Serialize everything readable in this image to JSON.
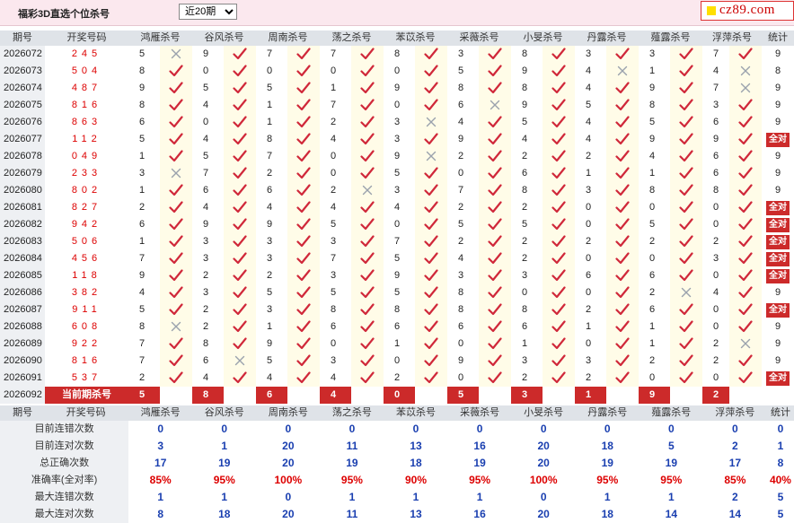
{
  "header": {
    "title": "福彩3D直选个位杀号",
    "period_select": {
      "selected": "近20期",
      "options": [
        "近20期"
      ]
    },
    "logo_text": "cz89.com"
  },
  "columns": [
    "期号",
    "开奖号码",
    "鸿雁杀号",
    "谷风杀号",
    "周南杀号",
    "荡之杀号",
    "苯苡杀号",
    "采薇杀号",
    "小旻杀号",
    "丹露杀号",
    "薤露杀号",
    "浮萍杀号",
    "统计"
  ],
  "quan_dui_label": "全对",
  "rows": [
    {
      "period": "2026072",
      "draw": "245",
      "kills": [
        5,
        9,
        7,
        7,
        8,
        3,
        8,
        3,
        3,
        7
      ],
      "ok": [
        0,
        1,
        1,
        1,
        1,
        1,
        1,
        1,
        1,
        1
      ],
      "stat": "9"
    },
    {
      "period": "2026073",
      "draw": "504",
      "kills": [
        8,
        0,
        0,
        0,
        0,
        5,
        9,
        4,
        1,
        4
      ],
      "ok": [
        1,
        1,
        1,
        1,
        1,
        1,
        1,
        0,
        1,
        0
      ],
      "stat": "8"
    },
    {
      "period": "2026074",
      "draw": "487",
      "kills": [
        9,
        5,
        5,
        1,
        9,
        8,
        8,
        4,
        9,
        7
      ],
      "ok": [
        1,
        1,
        1,
        1,
        1,
        1,
        1,
        1,
        1,
        0
      ],
      "stat": "9"
    },
    {
      "period": "2026075",
      "draw": "816",
      "kills": [
        8,
        4,
        1,
        7,
        0,
        6,
        9,
        5,
        8,
        3
      ],
      "ok": [
        1,
        1,
        1,
        1,
        1,
        0,
        1,
        1,
        1,
        1
      ],
      "stat": "9"
    },
    {
      "period": "2026076",
      "draw": "863",
      "kills": [
        6,
        0,
        1,
        2,
        3,
        4,
        5,
        4,
        5,
        6
      ],
      "ok": [
        1,
        1,
        1,
        1,
        0,
        1,
        1,
        1,
        1,
        1
      ],
      "stat": "9"
    },
    {
      "period": "2026077",
      "draw": "112",
      "kills": [
        5,
        4,
        8,
        4,
        3,
        9,
        4,
        4,
        9,
        9
      ],
      "ok": [
        1,
        1,
        1,
        1,
        1,
        1,
        1,
        1,
        1,
        1
      ],
      "stat": "全对"
    },
    {
      "period": "2026078",
      "draw": "049",
      "kills": [
        1,
        5,
        7,
        0,
        9,
        2,
        2,
        2,
        4,
        6
      ],
      "ok": [
        1,
        1,
        1,
        1,
        0,
        1,
        1,
        1,
        1,
        1
      ],
      "stat": "9"
    },
    {
      "period": "2026079",
      "draw": "233",
      "kills": [
        3,
        7,
        2,
        0,
        5,
        0,
        6,
        1,
        1,
        6
      ],
      "ok": [
        0,
        1,
        1,
        1,
        1,
        1,
        1,
        1,
        1,
        1
      ],
      "stat": "9"
    },
    {
      "period": "2026080",
      "draw": "802",
      "kills": [
        1,
        6,
        6,
        2,
        3,
        7,
        8,
        3,
        8,
        8
      ],
      "ok": [
        1,
        1,
        1,
        0,
        1,
        1,
        1,
        1,
        1,
        1
      ],
      "stat": "9"
    },
    {
      "period": "2026081",
      "draw": "827",
      "kills": [
        2,
        4,
        4,
        4,
        4,
        2,
        2,
        0,
        0,
        0
      ],
      "ok": [
        1,
        1,
        1,
        1,
        1,
        1,
        1,
        1,
        1,
        1
      ],
      "stat": "全对"
    },
    {
      "period": "2026082",
      "draw": "942",
      "kills": [
        6,
        9,
        9,
        5,
        0,
        5,
        5,
        0,
        5,
        0
      ],
      "ok": [
        1,
        1,
        1,
        1,
        1,
        1,
        1,
        1,
        1,
        1
      ],
      "stat": "全对"
    },
    {
      "period": "2026083",
      "draw": "506",
      "kills": [
        1,
        3,
        3,
        3,
        7,
        2,
        2,
        2,
        2,
        2
      ],
      "ok": [
        1,
        1,
        1,
        1,
        1,
        1,
        1,
        1,
        1,
        1
      ],
      "stat": "全对"
    },
    {
      "period": "2026084",
      "draw": "456",
      "kills": [
        7,
        3,
        3,
        7,
        5,
        4,
        2,
        0,
        0,
        3
      ],
      "ok": [
        1,
        1,
        1,
        1,
        1,
        1,
        1,
        1,
        1,
        1
      ],
      "stat": "全对"
    },
    {
      "period": "2026085",
      "draw": "118",
      "kills": [
        9,
        2,
        2,
        3,
        9,
        3,
        3,
        6,
        6,
        0
      ],
      "ok": [
        1,
        1,
        1,
        1,
        1,
        1,
        1,
        1,
        1,
        1
      ],
      "stat": "全对"
    },
    {
      "period": "2026086",
      "draw": "382",
      "kills": [
        4,
        3,
        5,
        5,
        5,
        8,
        0,
        0,
        2,
        4
      ],
      "ok": [
        1,
        1,
        1,
        1,
        1,
        1,
        1,
        1,
        0,
        1
      ],
      "stat": "9"
    },
    {
      "period": "2026087",
      "draw": "911",
      "kills": [
        5,
        2,
        3,
        8,
        8,
        8,
        8,
        2,
        6,
        0
      ],
      "ok": [
        1,
        1,
        1,
        1,
        1,
        1,
        1,
        1,
        1,
        1
      ],
      "stat": "全对"
    },
    {
      "period": "2026088",
      "draw": "608",
      "kills": [
        8,
        2,
        1,
        6,
        6,
        6,
        6,
        1,
        1,
        0
      ],
      "ok": [
        0,
        1,
        1,
        1,
        1,
        1,
        1,
        1,
        1,
        1
      ],
      "stat": "9"
    },
    {
      "period": "2026089",
      "draw": "922",
      "kills": [
        7,
        8,
        9,
        0,
        1,
        0,
        1,
        0,
        1,
        2
      ],
      "ok": [
        1,
        1,
        1,
        1,
        1,
        1,
        1,
        1,
        1,
        0
      ],
      "stat": "9"
    },
    {
      "period": "2026090",
      "draw": "816",
      "kills": [
        7,
        6,
        5,
        3,
        0,
        9,
        3,
        3,
        2,
        2
      ],
      "ok": [
        1,
        0,
        1,
        1,
        1,
        1,
        1,
        1,
        1,
        1
      ],
      "stat": "9"
    },
    {
      "period": "2026091",
      "draw": "537",
      "kills": [
        2,
        4,
        4,
        4,
        2,
        0,
        2,
        2,
        0,
        0
      ],
      "ok": [
        1,
        1,
        1,
        1,
        1,
        1,
        1,
        1,
        1,
        1
      ],
      "stat": "全对"
    }
  ],
  "current": {
    "period": "2026092",
    "label": "当前期杀号",
    "kills": [
      "5",
      "8",
      "6",
      "4",
      "0",
      "5",
      "3",
      "1",
      "9",
      "2"
    ]
  },
  "stats": {
    "header_period": "期号",
    "header_draw": "开奖号码",
    "rows": [
      {
        "label": "目前连错次数",
        "values": [
          "0",
          "0",
          "0",
          "0",
          "0",
          "0",
          "0",
          "0",
          "0",
          "0",
          "0"
        ]
      },
      {
        "label": "目前连对次数",
        "values": [
          "3",
          "1",
          "20",
          "11",
          "13",
          "16",
          "20",
          "18",
          "5",
          "2",
          "1"
        ]
      },
      {
        "label": "总正确次数",
        "values": [
          "17",
          "19",
          "20",
          "19",
          "18",
          "19",
          "20",
          "19",
          "19",
          "17",
          "8"
        ]
      },
      {
        "label": "准确率(全对率)",
        "values": [
          "85%",
          "95%",
          "100%",
          "95%",
          "90%",
          "95%",
          "100%",
          "95%",
          "95%",
          "85%",
          "40%"
        ],
        "pct": true
      },
      {
        "label": "最大连错次数",
        "values": [
          "1",
          "1",
          "0",
          "1",
          "1",
          "1",
          "0",
          "1",
          "1",
          "2",
          "5"
        ]
      },
      {
        "label": "最大连对次数",
        "values": [
          "8",
          "18",
          "20",
          "11",
          "13",
          "16",
          "20",
          "18",
          "14",
          "14",
          "5"
        ]
      }
    ]
  },
  "colors": {
    "check": "#d0283a",
    "cross": "#9aa2ad",
    "accent": "#cc2a2a",
    "stat_blue": "#1a3fb0"
  }
}
